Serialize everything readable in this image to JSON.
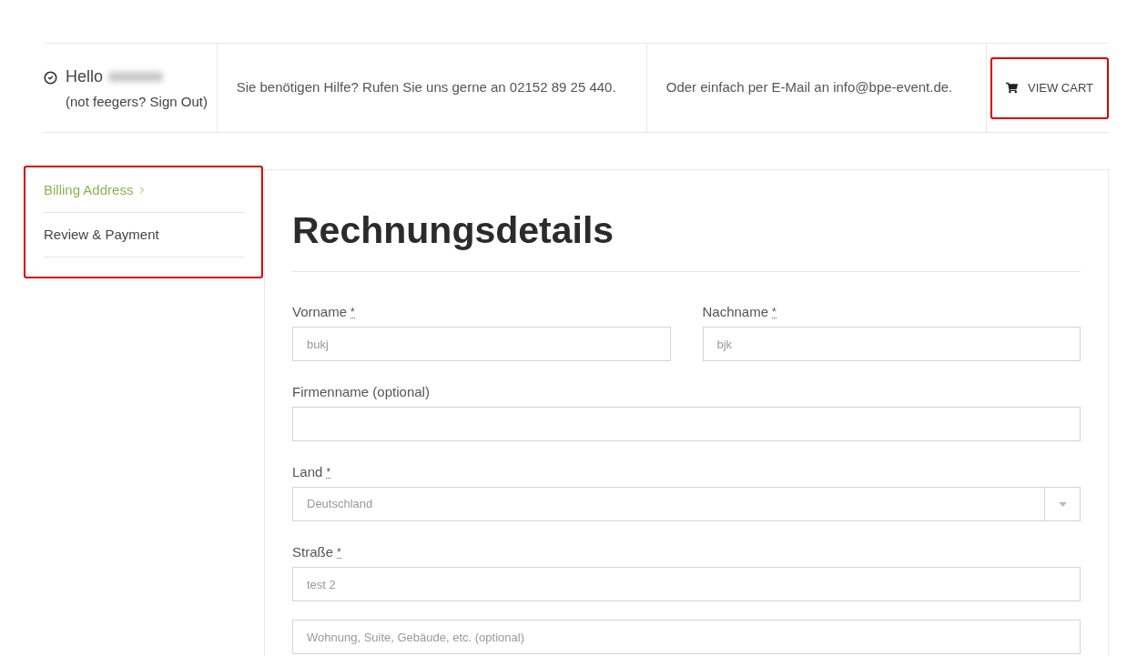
{
  "header": {
    "greeting": "Hello",
    "name_hidden": true,
    "signout_note": "(not feegers? Sign Out)",
    "help_text": "Sie benötigen Hilfe? Rufen Sie uns gerne an 02152 89 25 440.",
    "email_text": "Oder einfach per E-Mail an info@bpe-event.de.",
    "cart_button": {
      "label": "VIEW CART",
      "highlighted": true
    }
  },
  "steps": {
    "highlighted": true,
    "items": [
      {
        "label": "Billing Address",
        "selected": true
      },
      {
        "label": "Review & Payment",
        "selected": false
      }
    ]
  },
  "form": {
    "title": "Rechnungsdetails",
    "rows": [
      [
        {
          "kind": "text",
          "label": "Vorname",
          "required_mark": "*",
          "value": "bukj"
        },
        {
          "kind": "text",
          "label": "Nachname",
          "required_mark": "*",
          "value": "bjk"
        }
      ],
      [
        {
          "kind": "text",
          "label": "Firmenname (optional)"
        }
      ],
      [
        {
          "kind": "select",
          "label": "Land",
          "required_mark": "*",
          "value": "Deutschland"
        }
      ],
      [
        {
          "kind": "text",
          "label": "Straße",
          "required_mark": "*",
          "value": "test 2"
        }
      ],
      [
        {
          "kind": "text",
          "placeholder": "Wohnung, Suite, Gebäude, etc. (optional)"
        }
      ]
    ]
  }
}
